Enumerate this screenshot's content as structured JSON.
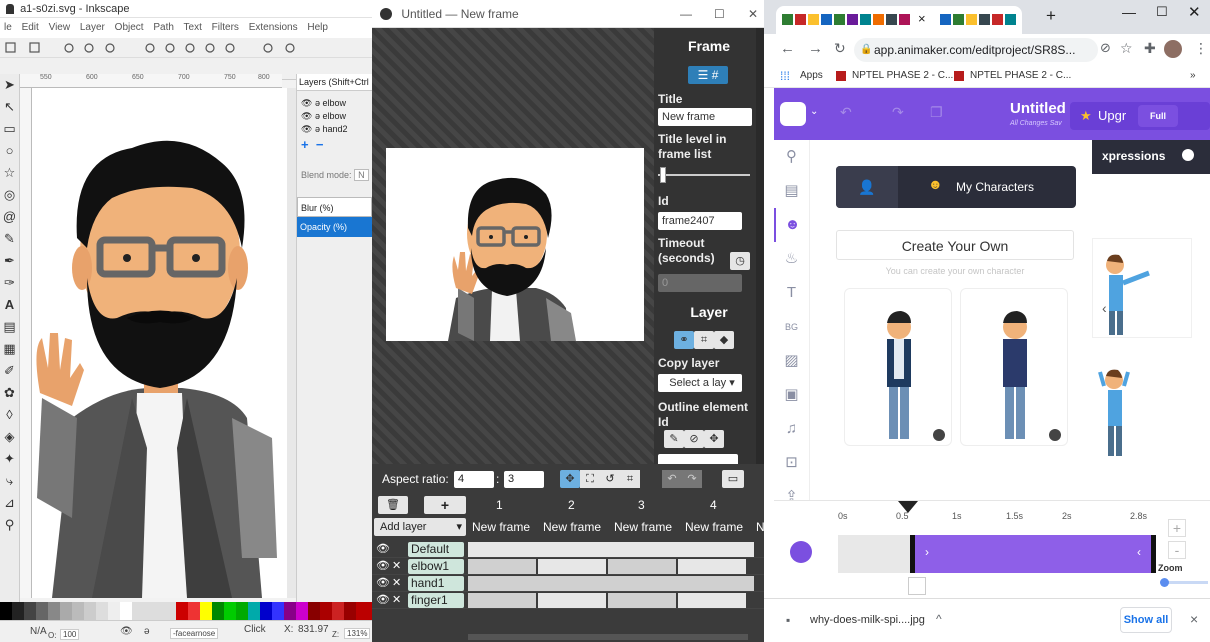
{
  "inkscape": {
    "title": "a1-s0zi.svg - Inkscape",
    "menu": [
      "le",
      "Edit",
      "View",
      "Layer",
      "Object",
      "Path",
      "Text",
      "Filters",
      "Extensions",
      "Help"
    ],
    "ruler": [
      "550",
      "600",
      "650",
      "700",
      "750",
      "800"
    ],
    "layers_tab": "Layers (Shift+Ctrl",
    "layers": [
      "elbow",
      "elbow",
      "hand2"
    ],
    "blend_mode": "Blend mode:",
    "blend_value": "N",
    "blur": "Blur (%)",
    "opacity": "Opacity (%)",
    "status": {
      "na": "N/A",
      "o": "O:",
      "o_value": "100",
      "layer": "-facearnose",
      "click": "Click",
      "x": "X:",
      "x_value": "831.97",
      "z": "Z:",
      "zoom": "131%"
    }
  },
  "frame_editor": {
    "title": "Untitled — New frame",
    "panel": {
      "frame_heading": "Frame",
      "title_label": "Title",
      "title_value": "New frame",
      "title_level": "Title level in frame list",
      "id_label": "Id",
      "id_value": "frame2407",
      "timeout_label": "Timeout (seconds)",
      "timeout_value": "0",
      "layer_heading": "Layer",
      "copy_layer": "Copy layer",
      "select_layer": "Select a lay",
      "outline_label": "Outline element Id"
    },
    "aspect_label": "Aspect ratio:",
    "aspect_w": "4",
    "aspect_h": "3",
    "add_layer": "Add layer",
    "frame_numbers": [
      "1",
      "2",
      "3",
      "4"
    ],
    "frame_names": [
      "New frame",
      "New frame",
      "New frame",
      "New frame",
      "N"
    ],
    "layers": [
      "Default",
      "elbow1",
      "hand1",
      "finger1"
    ]
  },
  "chrome": {
    "tab_close": "×",
    "new_tab": "+",
    "url": "app.animaker.com/editproject/SR8S...",
    "apps": "Apps",
    "bookmarks": [
      "NPTEL PHASE 2 - C...",
      "NPTEL PHASE 2 - C..."
    ],
    "more_bookmarks": "»",
    "app": {
      "title": "Untitled",
      "subtitle": "All Changes Sav",
      "upgrade": "Upgr",
      "full": "Full",
      "my_characters": "My Characters",
      "expressions": "xpressions",
      "create_own": "Create Your Own",
      "create_sub": "You can create your own character",
      "ruler": [
        "0s",
        "0.5",
        "1s",
        "1.5s",
        "2s",
        "2.8s"
      ],
      "zoom": "Zoom",
      "zoom_minus": "-",
      "zoom_plus": "+"
    },
    "download": {
      "file": "why-does-milk-spi....jpg",
      "show_all": "Show all",
      "close": "×"
    }
  },
  "colors": {
    "accent_purple": "#7b4fe0",
    "frame_panel": "#333333",
    "chrome_tab": "#dee1e6"
  }
}
